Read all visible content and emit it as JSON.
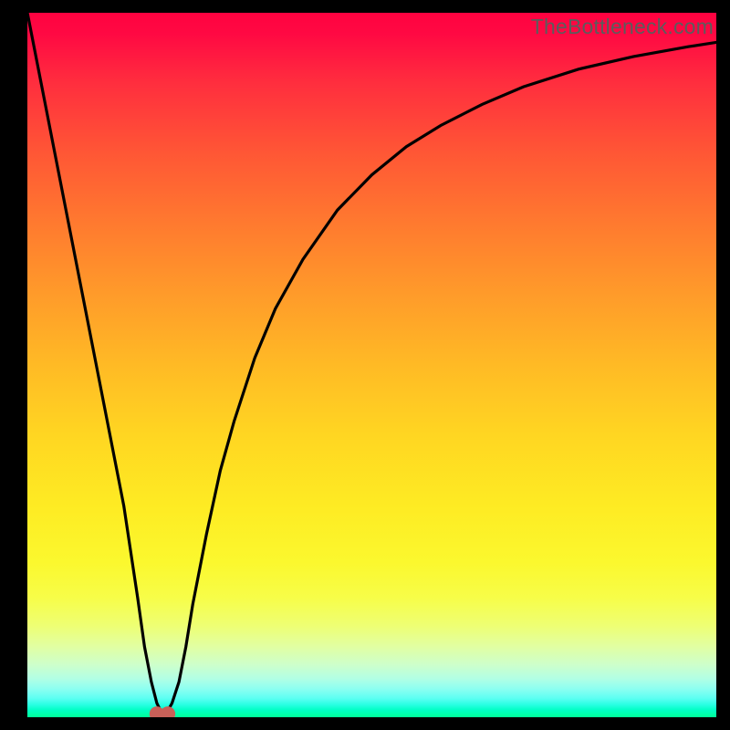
{
  "watermark": "TheBottleneck.com",
  "chart_data": {
    "type": "line",
    "title": "",
    "xlabel": "",
    "ylabel": "",
    "xlim": [
      0,
      100
    ],
    "ylim": [
      0,
      100
    ],
    "series": [
      {
        "name": "bottleneck-curve",
        "x": [
          0,
          2,
          4,
          6,
          8,
          10,
          12,
          14,
          16,
          17,
          18,
          18.8,
          19.5,
          20.2,
          21,
          22,
          23,
          24,
          26,
          28,
          30,
          33,
          36,
          40,
          45,
          50,
          55,
          60,
          66,
          72,
          80,
          88,
          96,
          100
        ],
        "y": [
          100,
          90,
          80,
          70,
          60,
          50,
          40,
          30,
          17,
          10,
          5,
          2,
          0.6,
          0.6,
          2,
          5,
          10,
          16,
          26,
          35,
          42,
          51,
          58,
          65,
          72,
          77,
          81,
          84,
          87,
          89.5,
          92,
          93.8,
          95.2,
          95.8
        ]
      }
    ],
    "markers": [
      {
        "name": "left-marker",
        "x": 18.8,
        "y": 0.6
      },
      {
        "name": "right-marker",
        "x": 20.4,
        "y": 0.6
      }
    ],
    "gradient_stops": [
      {
        "pos": 0,
        "color": "#ff0240"
      },
      {
        "pos": 50,
        "color": "#ffba25"
      },
      {
        "pos": 83,
        "color": "#f7fd48"
      },
      {
        "pos": 100,
        "color": "#00ff99"
      }
    ]
  }
}
